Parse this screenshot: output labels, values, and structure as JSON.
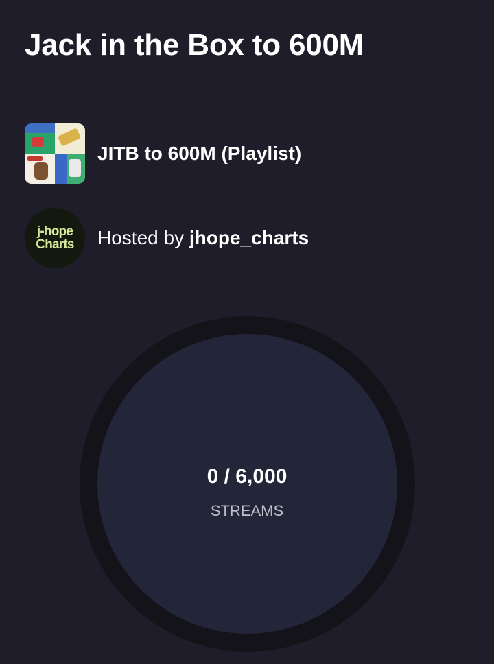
{
  "page": {
    "title": "Jack in the Box to 600M"
  },
  "playlist": {
    "title": "JITB to 600M (Playlist)",
    "cover_icon": "album-collage-icon"
  },
  "host": {
    "prefix": "Hosted by",
    "name": "jhope_charts",
    "avatar_line1": "j-hope",
    "avatar_line2": "Charts"
  },
  "progress": {
    "current": "0",
    "target": "6,000",
    "display": "0 / 6,000",
    "unit": "STREAMS",
    "fraction": 0
  },
  "colors": {
    "background": "#1e1d29",
    "ring_track": "#141319",
    "ring_center": "#232639",
    "avatar_text": "#d6e89a"
  }
}
